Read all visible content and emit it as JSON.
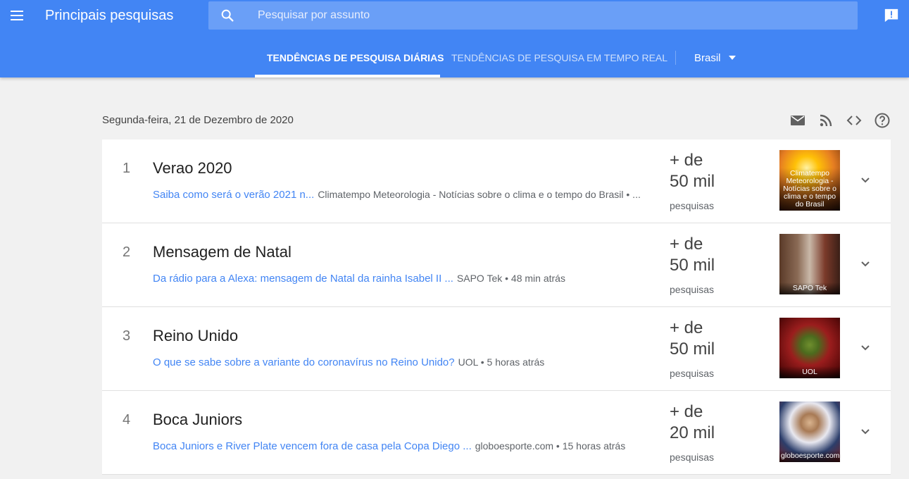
{
  "app": {
    "title": "Principais pesquisas"
  },
  "search": {
    "placeholder": "Pesquisar por assunto"
  },
  "tabs": [
    {
      "label": "TENDÊNCIAS DE PESQUISA DIÁRIAS",
      "active": true
    },
    {
      "label": "TENDÊNCIAS DE PESQUISA EM TEMPO REAL",
      "active": false
    }
  ],
  "country": {
    "selected": "Brasil"
  },
  "date": "Segunda-feira, 21 de Dezembro de 2020",
  "tool_icons": [
    "mail-icon",
    "rss-icon",
    "embed-code-icon",
    "help-icon"
  ],
  "colors": {
    "header": "#4285f4",
    "link": "#4285f4",
    "background": "#f1f1f1"
  },
  "trends": [
    {
      "rank": "1",
      "term": "Verao 2020",
      "article_title": "Saiba como será o verão 2021 n...",
      "article_source": "Climatempo Meteorologia - Notícias sobre o clima e o tempo do Brasil • ...",
      "count_line1": "+ de",
      "count_line2": "50 mil",
      "count_label": "pesquisas",
      "thumb_caption": "Climatempo Meteorologia - Notícias sobre o clima e o tempo do Brasil"
    },
    {
      "rank": "2",
      "term": "Mensagem de Natal",
      "article_title": "Da rádio para a Alexa: mensagem de Natal da rainha Isabel II ...",
      "article_source": "SAPO Tek • 48 min atrás",
      "count_line1": "+ de",
      "count_line2": "50 mil",
      "count_label": "pesquisas",
      "thumb_caption": "SAPO Tek"
    },
    {
      "rank": "3",
      "term": "Reino Unido",
      "article_title": "O que se sabe sobre a variante do coronavírus no Reino Unido?",
      "article_source": "UOL • 5 horas atrás",
      "count_line1": "+ de",
      "count_line2": "50 mil",
      "count_label": "pesquisas",
      "thumb_caption": "UOL"
    },
    {
      "rank": "4",
      "term": "Boca Juniors",
      "article_title": "Boca Juniors e River Plate vencem fora de casa pela Copa Diego ...",
      "article_source": "globoesporte.com • 15 horas atrás",
      "count_line1": "+ de",
      "count_line2": "20 mil",
      "count_label": "pesquisas",
      "thumb_caption": "globoesporte.com"
    }
  ]
}
